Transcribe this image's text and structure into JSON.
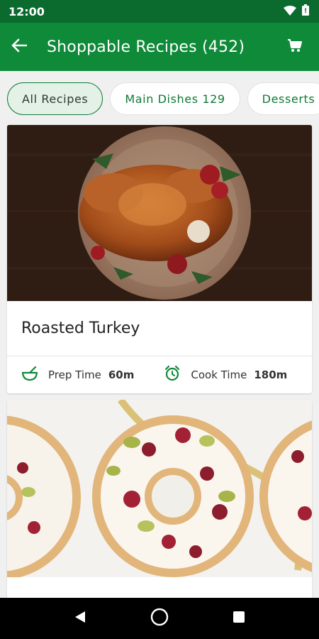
{
  "status_bar": {
    "time": "12:00",
    "icons": [
      "wifi-icon",
      "battery-icon"
    ]
  },
  "app_bar": {
    "title": "Shoppable Recipes (452)",
    "icons": [
      "back-arrow-icon",
      "cart-icon"
    ]
  },
  "categories": [
    {
      "label": "All Recipes",
      "selected": true
    },
    {
      "label": "Main Dishes 129",
      "selected": false
    },
    {
      "label": "Desserts",
      "selected": false
    }
  ],
  "recipes": [
    {
      "title": "Roasted Turkey",
      "prep_label": "Prep Time",
      "prep_value": "60m",
      "cook_label": "Cook Time",
      "cook_value": "180m"
    }
  ],
  "colors": {
    "primary": "#0f8a39",
    "status_bar": "#0b6b2e",
    "chip_selected_bg": "#e3f1e6",
    "accent_text": "#0f7a34"
  },
  "nav_bar": {
    "icons": [
      "back-triangle-icon",
      "home-circle-icon",
      "recents-square-icon"
    ]
  }
}
